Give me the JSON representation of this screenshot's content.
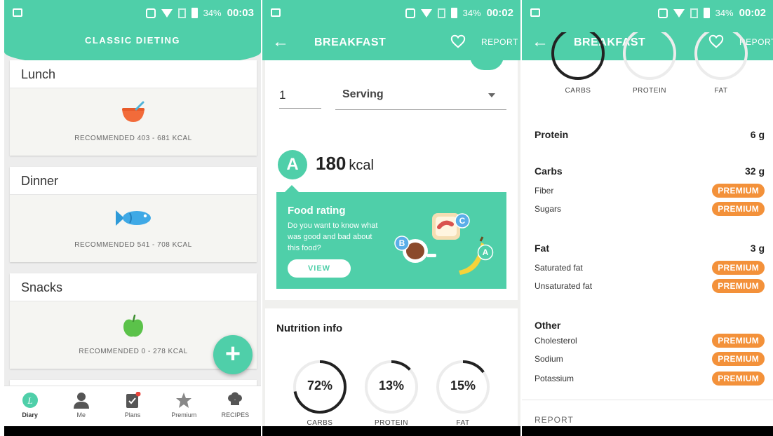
{
  "status": {
    "battery": "34%",
    "time_left": "00:03",
    "time_mid": "00:02",
    "time_right": "00:02"
  },
  "colors": {
    "accent": "#4fcfa9",
    "premium": "#f3913a"
  },
  "screen1": {
    "header_title": "CLASSIC DIETING",
    "meals": [
      {
        "title": "Lunch",
        "icon": "bowl-icon",
        "recommended": "RECOMMENDED 403 - 681 KCAL"
      },
      {
        "title": "Dinner",
        "icon": "fish-icon",
        "recommended": "RECOMMENDED 541 - 708 KCAL"
      },
      {
        "title": "Snacks",
        "icon": "apple-icon",
        "recommended": "RECOMMENDED 0 - 278 KCAL"
      }
    ],
    "fab_label": "+",
    "nav": [
      {
        "label": "Diary",
        "icon": "diary-icon",
        "active": true
      },
      {
        "label": "Me",
        "icon": "person-icon"
      },
      {
        "label": "Plans",
        "icon": "clipboard-icon"
      },
      {
        "label": "Premium",
        "icon": "star-icon"
      },
      {
        "label": "RECIPES",
        "icon": "chef-hat-icon"
      }
    ]
  },
  "screen2": {
    "title": "BREAKFAST",
    "report": "REPORT",
    "quantity": "1",
    "serving": "Serving",
    "grade": "A",
    "kcal_value": "180",
    "kcal_unit": "kcal",
    "rating_title": "Food rating",
    "rating_text": "Do you want to know what was good and bad about this food?",
    "view_button": "VIEW",
    "badges": [
      "B",
      "C",
      "A"
    ],
    "nutrition_title": "Nutrition info",
    "rings": [
      {
        "label": "72%",
        "name": "CARBS",
        "value": 72
      },
      {
        "label": "13%",
        "name": "PROTEIN",
        "value": 13
      },
      {
        "label": "15%",
        "name": "FAT",
        "value": 15
      }
    ]
  },
  "screen3": {
    "title": "BREAKFAST",
    "report": "REPORT",
    "ring_names": [
      "CARBS",
      "PROTEIN",
      "FAT"
    ],
    "protein": {
      "label": "Protein",
      "value": "6 g"
    },
    "carbs": {
      "label": "Carbs",
      "value": "32 g",
      "items": [
        "Fiber",
        "Sugars"
      ]
    },
    "fat": {
      "label": "Fat",
      "value": "3 g",
      "items": [
        "Saturated fat",
        "Unsaturated fat"
      ]
    },
    "other": {
      "label": "Other",
      "items": [
        "Cholesterol",
        "Sodium",
        "Potassium"
      ]
    },
    "premium_label": "PREMIUM",
    "footer": "REPORT"
  }
}
